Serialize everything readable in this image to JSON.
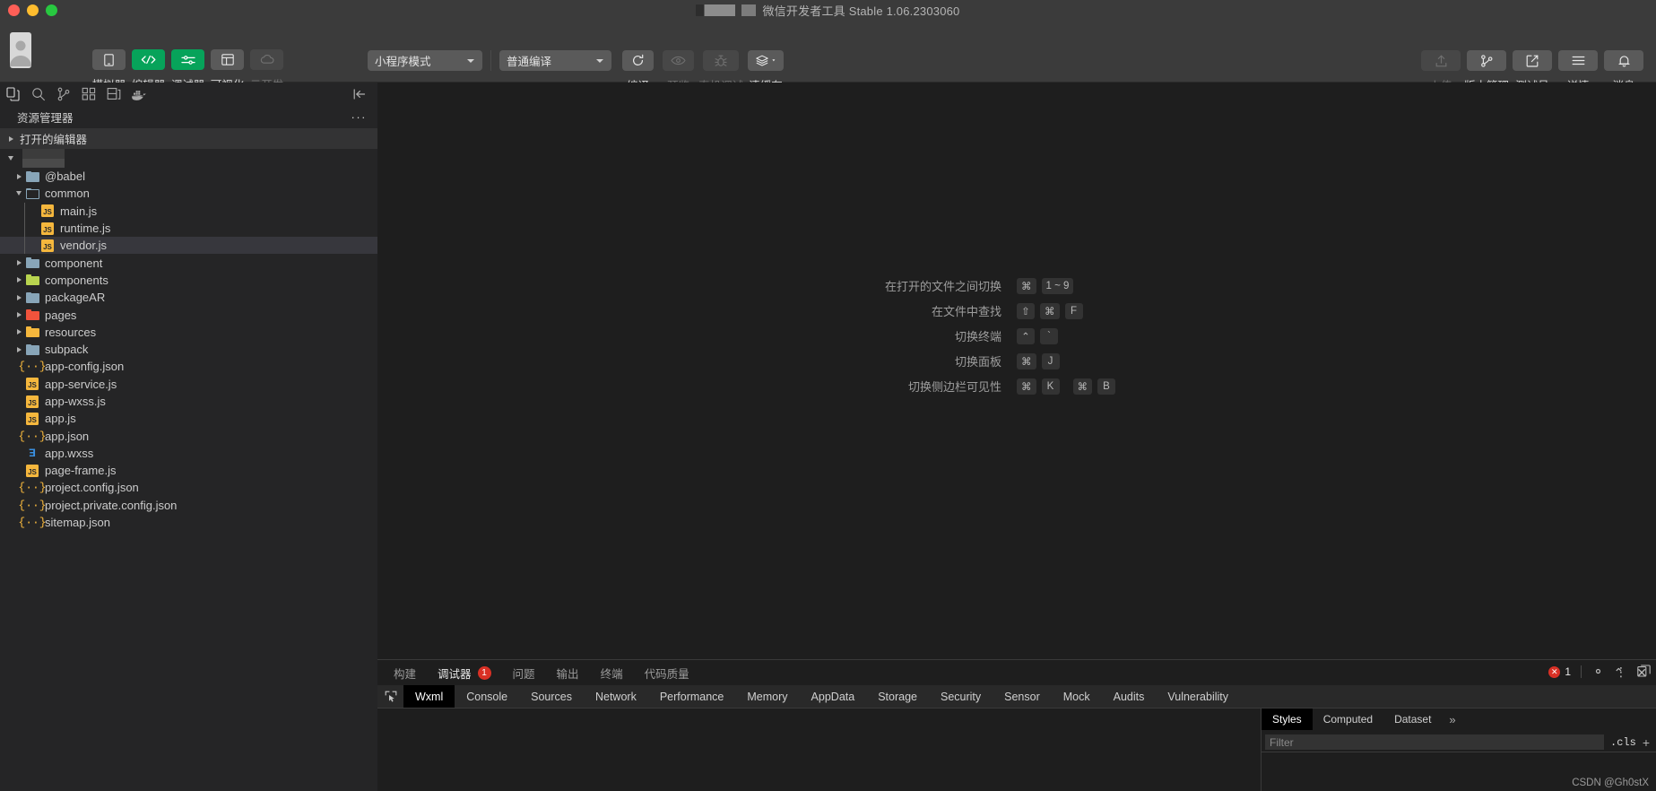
{
  "window": {
    "title": "微信开发者工具 Stable 1.06.2303060",
    "traffic_lights": [
      "close",
      "minimize",
      "maximize"
    ],
    "colors": {
      "close": "#ff5f57",
      "minimize": "#ffbd2e",
      "maximize": "#28c840",
      "accent_green": "#07a35a",
      "error_red": "#d93025"
    }
  },
  "toolbar": {
    "avatar_icon": "user-avatar-icon",
    "left_buttons": [
      {
        "label": "模拟器",
        "icon": "simulator-icon",
        "state": "normal"
      },
      {
        "label": "编辑器",
        "icon": "code-icon",
        "state": "active"
      },
      {
        "label": "调试器",
        "icon": "sliders-icon",
        "state": "active"
      },
      {
        "label": "可视化",
        "icon": "layout-icon",
        "state": "normal"
      },
      {
        "label": "云开发",
        "icon": "cloud-icon",
        "state": "disabled"
      }
    ],
    "mode_select": {
      "value": "小程序模式",
      "icon": "chevron-down-icon"
    },
    "compile_select": {
      "value": "普通编译",
      "icon": "chevron-down-icon"
    },
    "compile_buttons": [
      {
        "label": "编译",
        "icon": "refresh-icon",
        "state": "normal"
      },
      {
        "label": "预览",
        "icon": "eye-icon",
        "state": "disabled"
      },
      {
        "label": "真机调试",
        "icon": "bug-icon",
        "state": "disabled"
      },
      {
        "label": "清缓存",
        "icon": "layers-icon",
        "state": "normal",
        "has_caret": true
      }
    ],
    "right_buttons": [
      {
        "label": "上传",
        "icon": "upload-icon",
        "state": "disabled"
      },
      {
        "label": "版本管理",
        "icon": "git-branch-icon",
        "state": "normal"
      },
      {
        "label": "测试号",
        "icon": "external-link-icon",
        "state": "normal"
      },
      {
        "label": "详情",
        "icon": "list-icon",
        "state": "normal"
      },
      {
        "label": "消息",
        "icon": "bell-icon",
        "state": "normal"
      }
    ]
  },
  "activity_bar": {
    "icons": [
      {
        "name": "explorer-icon"
      },
      {
        "name": "search-icon"
      },
      {
        "name": "source-control-icon"
      },
      {
        "name": "extensions-icon"
      },
      {
        "name": "layout-panel-icon"
      },
      {
        "name": "docker-icon"
      }
    ],
    "collapse_icon": "collapse-sidebar-icon"
  },
  "sidebar": {
    "title": "资源管理器",
    "more_label": "···",
    "sections": [
      {
        "label": "打开的编辑器",
        "expanded": false
      }
    ],
    "tree": [
      {
        "name": "@babel",
        "type": "folder",
        "icon": "folder-icon",
        "color": "blue",
        "depth": 1,
        "expanded": false
      },
      {
        "name": "common",
        "type": "folder",
        "icon": "folder-open-icon",
        "color": "blue",
        "depth": 1,
        "expanded": true
      },
      {
        "name": "main.js",
        "type": "file",
        "icon": "js-file-icon",
        "depth": 2
      },
      {
        "name": "runtime.js",
        "type": "file",
        "icon": "js-file-icon",
        "depth": 2
      },
      {
        "name": "vendor.js",
        "type": "file",
        "icon": "js-file-icon",
        "depth": 2,
        "selected": true
      },
      {
        "name": "component",
        "type": "folder",
        "icon": "folder-icon",
        "color": "blue",
        "depth": 1,
        "expanded": false
      },
      {
        "name": "components",
        "type": "folder",
        "icon": "folder-icon",
        "color": "green",
        "depth": 1,
        "expanded": false
      },
      {
        "name": "packageAR",
        "type": "folder",
        "icon": "folder-icon",
        "color": "blue",
        "depth": 1,
        "expanded": false
      },
      {
        "name": "pages",
        "type": "folder",
        "icon": "folder-icon",
        "color": "red",
        "depth": 1,
        "expanded": false
      },
      {
        "name": "resources",
        "type": "folder",
        "icon": "folder-icon",
        "color": "orange",
        "depth": 1,
        "expanded": false
      },
      {
        "name": "subpack",
        "type": "folder",
        "icon": "folder-icon",
        "color": "blue",
        "depth": 1,
        "expanded": false
      },
      {
        "name": "app-config.json",
        "type": "file",
        "icon": "json-file-icon",
        "depth": 1
      },
      {
        "name": "app-service.js",
        "type": "file",
        "icon": "js-file-icon",
        "depth": 1
      },
      {
        "name": "app-wxss.js",
        "type": "file",
        "icon": "js-file-icon",
        "depth": 1
      },
      {
        "name": "app.js",
        "type": "file",
        "icon": "js-file-icon",
        "depth": 1
      },
      {
        "name": "app.json",
        "type": "file",
        "icon": "json-file-icon",
        "depth": 1
      },
      {
        "name": "app.wxss",
        "type": "file",
        "icon": "wxss-file-icon",
        "depth": 1
      },
      {
        "name": "page-frame.js",
        "type": "file",
        "icon": "js-file-icon",
        "depth": 1
      },
      {
        "name": "project.config.json",
        "type": "file",
        "icon": "json-file-icon",
        "depth": 1
      },
      {
        "name": "project.private.config.json",
        "type": "file",
        "icon": "json-file-icon",
        "depth": 1
      },
      {
        "name": "sitemap.json",
        "type": "file",
        "icon": "json-file-icon",
        "depth": 1
      }
    ]
  },
  "editor_welcome": {
    "shortcuts": [
      {
        "label": "在打开的文件之间切换",
        "keys": [
          "⌘",
          "1 ~ 9"
        ]
      },
      {
        "label": "在文件中查找",
        "keys": [
          "⇧",
          "⌘",
          "F"
        ]
      },
      {
        "label": "切换终端",
        "keys": [
          "⌃",
          "`"
        ]
      },
      {
        "label": "切换面板",
        "keys": [
          "⌘",
          "J"
        ]
      },
      {
        "label": "切换侧边栏可见性",
        "keys": [
          "⌘",
          "K",
          "⌘",
          "B"
        ]
      }
    ]
  },
  "bottom_panel": {
    "tabs": [
      {
        "label": "构建",
        "active": false
      },
      {
        "label": "调试器",
        "active": true,
        "badge": "1"
      },
      {
        "label": "问题",
        "active": false
      },
      {
        "label": "输出",
        "active": false
      },
      {
        "label": "终端",
        "active": false
      },
      {
        "label": "代码质量",
        "active": false
      }
    ],
    "actions": [
      {
        "name": "chevron-up-icon",
        "glyph": "⌃"
      },
      {
        "name": "close-icon",
        "glyph": "✕"
      }
    ],
    "devtools": {
      "inspect_icon": "inspect-element-icon",
      "tabs": [
        {
          "label": "Wxml",
          "active": true
        },
        {
          "label": "Console",
          "active": false
        },
        {
          "label": "Sources",
          "active": false
        },
        {
          "label": "Network",
          "active": false
        },
        {
          "label": "Performance",
          "active": false
        },
        {
          "label": "Memory",
          "active": false
        },
        {
          "label": "AppData",
          "active": false
        },
        {
          "label": "Storage",
          "active": false
        },
        {
          "label": "Security",
          "active": false
        },
        {
          "label": "Sensor",
          "active": false
        },
        {
          "label": "Mock",
          "active": false
        },
        {
          "label": "Audits",
          "active": false
        },
        {
          "label": "Vulnerability",
          "active": false
        }
      ],
      "error_count": "1",
      "right_icons": [
        {
          "name": "gear-icon"
        },
        {
          "name": "more-vertical-icon"
        },
        {
          "name": "dock-panel-icon"
        }
      ]
    },
    "styles_pane": {
      "tabs": [
        {
          "label": "Styles",
          "active": true
        },
        {
          "label": "Computed",
          "active": false
        },
        {
          "label": "Dataset",
          "active": false
        }
      ],
      "more_icon": "chevron-double-right-icon",
      "filter_placeholder": "Filter",
      "cls_label": ".cls",
      "add_rule_icon": "plus-icon"
    }
  },
  "watermark": "CSDN @Gh0stX"
}
